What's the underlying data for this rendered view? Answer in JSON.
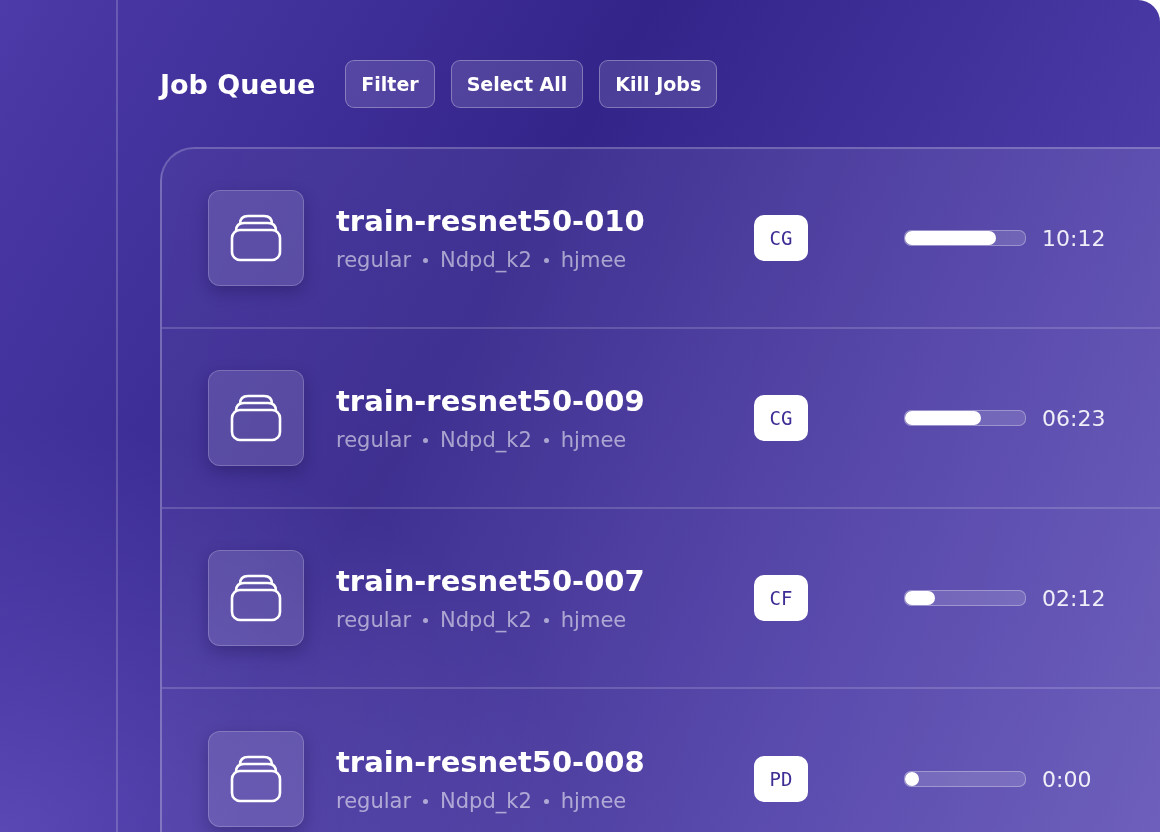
{
  "header": {
    "title": "Job Queue",
    "buttons": [
      "Filter",
      "Select All",
      "Kill Jobs"
    ]
  },
  "jobs": [
    {
      "name": "train-resnet50-010",
      "meta": [
        "regular",
        "Ndpd_k2",
        "hjmee"
      ],
      "status": "CG",
      "level": 0.76,
      "time": "10:12"
    },
    {
      "name": "train-resnet50-009",
      "meta": [
        "regular",
        "Ndpd_k2",
        "hjmee"
      ],
      "status": "CG",
      "level": 0.63,
      "time": "06:23"
    },
    {
      "name": "train-resnet50-007",
      "meta": [
        "regular",
        "Ndpd_k2",
        "hjmee"
      ],
      "status": "CF",
      "level": 0.25,
      "time": "02:12"
    },
    {
      "name": "train-resnet50-008",
      "meta": [
        "regular",
        "Ndpd_k2",
        "hjmee"
      ],
      "status": "PD",
      "level": 0.05,
      "time": "0:00"
    }
  ]
}
